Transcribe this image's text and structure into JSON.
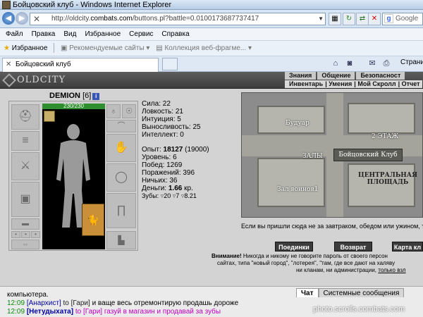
{
  "window": {
    "title": "Бойцовский клуб - Windows Internet Explorer"
  },
  "address_bar": {
    "url_prefix": "http://oldcity.",
    "url_domain": "combats.com",
    "url_suffix": "/buttons.pl?battle=0.0100173687737417",
    "search_placeholder": "Google"
  },
  "menu": [
    "Файл",
    "Правка",
    "Вид",
    "Избранное",
    "Сервис",
    "Справка"
  ],
  "favorites_bar": {
    "favorites_label": "Избранное",
    "item1": "Рекомендуемые сайты",
    "item2": "Коллекция веб-фрагме..."
  },
  "tab": {
    "label": "Бойцовский клуб"
  },
  "command_bar": {
    "pages_label": "Страни"
  },
  "game": {
    "logo": "OLDCITY",
    "top_nav": [
      "Знания",
      "Общение",
      "Безопасност"
    ],
    "sub_nav": [
      "Инвентарь",
      "Умения",
      "Мой Скролл",
      "Отчет"
    ],
    "char_name": "DEMION",
    "char_level": "[6]",
    "hp_text": "230/230",
    "hp_fraction": 1.0,
    "stats": {
      "strength": "Сила: 22",
      "agility": "Ловкость: 21",
      "intuition": "Интуиция: 5",
      "endurance": "Выносливость: 25",
      "intellect": "Интеллект: 0",
      "exp_label": "Опыт:",
      "exp_value": "18127",
      "exp_next": "(19000)",
      "level": "Уровень: 6",
      "wins": "Побед: 1269",
      "losses": "Поражений: 396",
      "draws": "Ничьих: 36",
      "money_label": "Деньги:",
      "money_value": "1.66",
      "money_unit": "кр.",
      "teeth_label": "Зубы:",
      "teeth_a": "20",
      "teeth_b": "7",
      "teeth_c": "8.21"
    },
    "map": {
      "boudoir": "Будуар",
      "floor2": "2 ЭТАЖ",
      "club": "Бойцовский Клуб",
      "halls": "ЗАЛЫ",
      "central_1": "ЦЕНТРАЛЬНАЯ",
      "central_2": "ПЛОЩАДЬ",
      "warrior_hall": "Зал воинов1"
    },
    "map_banner": "Если вы пришли сюда не за завтраком, обедом или ужином, то",
    "buttons": {
      "fights": "Поединки",
      "back": "Возврат",
      "city_map": "Карта кл"
    },
    "warning": {
      "bold": "Внимание!",
      "line1": " Никогда и никому не говорите пароль от своего персон",
      "line2": "сайтах, типа \"новый город\", \"лотерея\", \"там, где все дают на халяву",
      "line3a": "ни кланам, ни администрации, ",
      "line3b": "только взл"
    }
  },
  "chat": {
    "tab_chat": "Чат",
    "tab_system": "Системные сообщения",
    "line0": "компьютера.",
    "line1": {
      "time": "12:09",
      "nick": "[Анархист]",
      "to": "to [Гари]",
      "msg": "и ваще весь отремонтирую продашь дороже"
    },
    "line2": {
      "time": "12:09",
      "nick": "[Нетудыхата]",
      "to": "to [Гари]",
      "msg": "газуй в магазин и продавай за зубы"
    }
  },
  "watermark": "photo.scrolls.combats.com",
  "colors": {
    "hp_green": "#2f8f2f",
    "chat_time": "#0a8a0a",
    "chat_nick": "#0000a0",
    "chat_msg_private": "#c000c0"
  }
}
